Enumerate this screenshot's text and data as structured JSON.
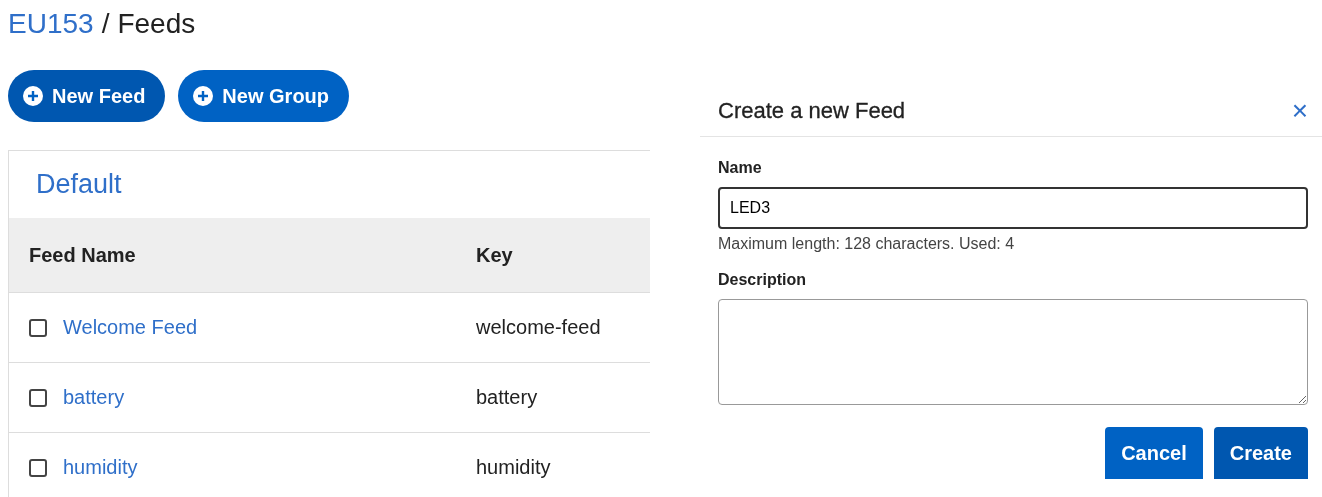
{
  "breadcrumb": {
    "parent": "EU153",
    "separator": "/",
    "current": "Feeds"
  },
  "actions": [
    {
      "label": "New Feed"
    },
    {
      "label": "New Group"
    }
  ],
  "group": {
    "title": "Default",
    "columns": [
      "Feed Name",
      "Key"
    ],
    "rows": [
      {
        "name": "Welcome Feed",
        "key": "welcome-feed",
        "checked": false
      },
      {
        "name": "battery",
        "key": "battery",
        "checked": false
      },
      {
        "name": "humidity",
        "key": "humidity",
        "checked": false
      }
    ]
  },
  "dialog": {
    "title": "Create a new Feed",
    "close": "×",
    "fields": [
      {
        "kind": "input",
        "label": "Name",
        "value": "LED3",
        "hint": "Maximum length: 128 characters. Used: 4"
      },
      {
        "kind": "textarea",
        "label": "Description"
      }
    ],
    "buttons": [
      "Cancel",
      "Create"
    ]
  }
}
